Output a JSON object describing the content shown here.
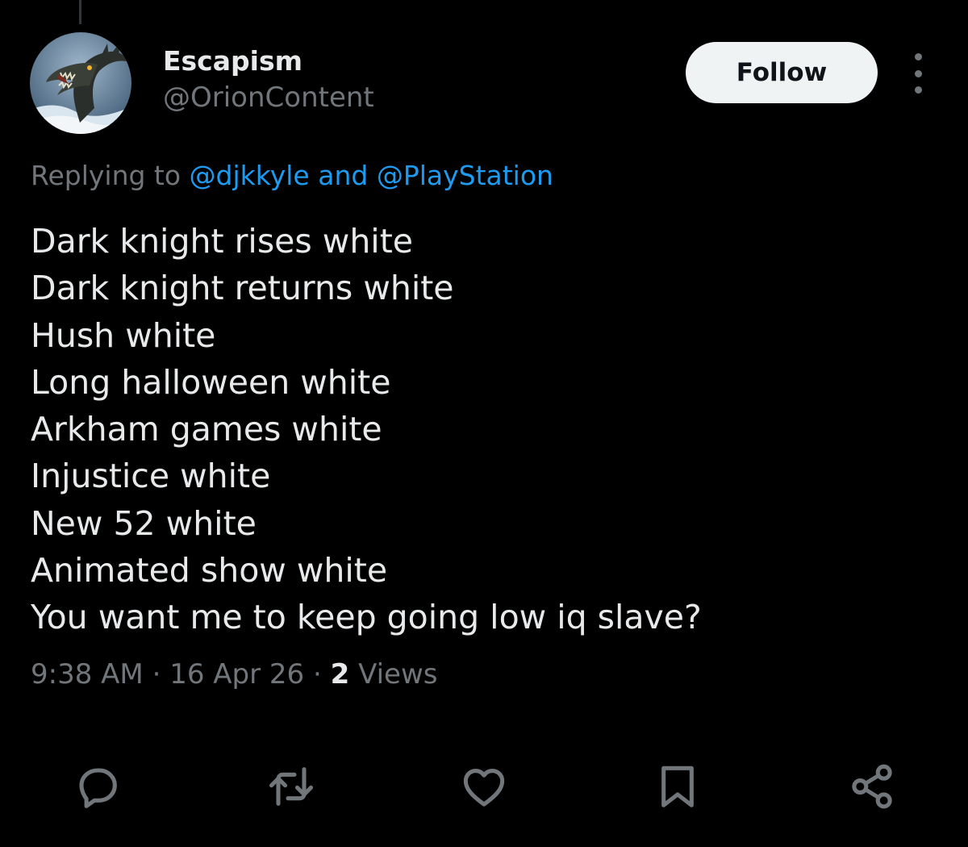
{
  "author": {
    "display_name": "Escapism",
    "handle": "@OrionContent",
    "avatar_icon": "dragon-avatar"
  },
  "follow_label": "Follow",
  "more_icon": "more-vertical-icon",
  "replying": {
    "prefix": "Replying to",
    "first_mention": "@djkkyle",
    "conjunction": "and",
    "second_mention": "@PlayStation"
  },
  "tweet": {
    "lines": [
      "Dark knight rises white",
      "Dark knight returns white",
      "Hush white",
      "Long halloween white",
      "Arkham games white",
      "Injustice white",
      "New 52 white",
      "Animated show white",
      "You want me to keep going low iq slave?"
    ]
  },
  "meta": {
    "time": "9:38 AM",
    "separator": "·",
    "date": "16 Apr 26",
    "views_count": "2",
    "views_label": "Views"
  },
  "actions": [
    "reply-icon",
    "retweet-icon",
    "like-icon",
    "bookmark-icon",
    "share-icon"
  ],
  "colors": {
    "background": "#000000",
    "text": "#e7e9ea",
    "secondary": "#71767b",
    "link": "#1d9bf0",
    "follow_bg": "#eff3f4"
  }
}
